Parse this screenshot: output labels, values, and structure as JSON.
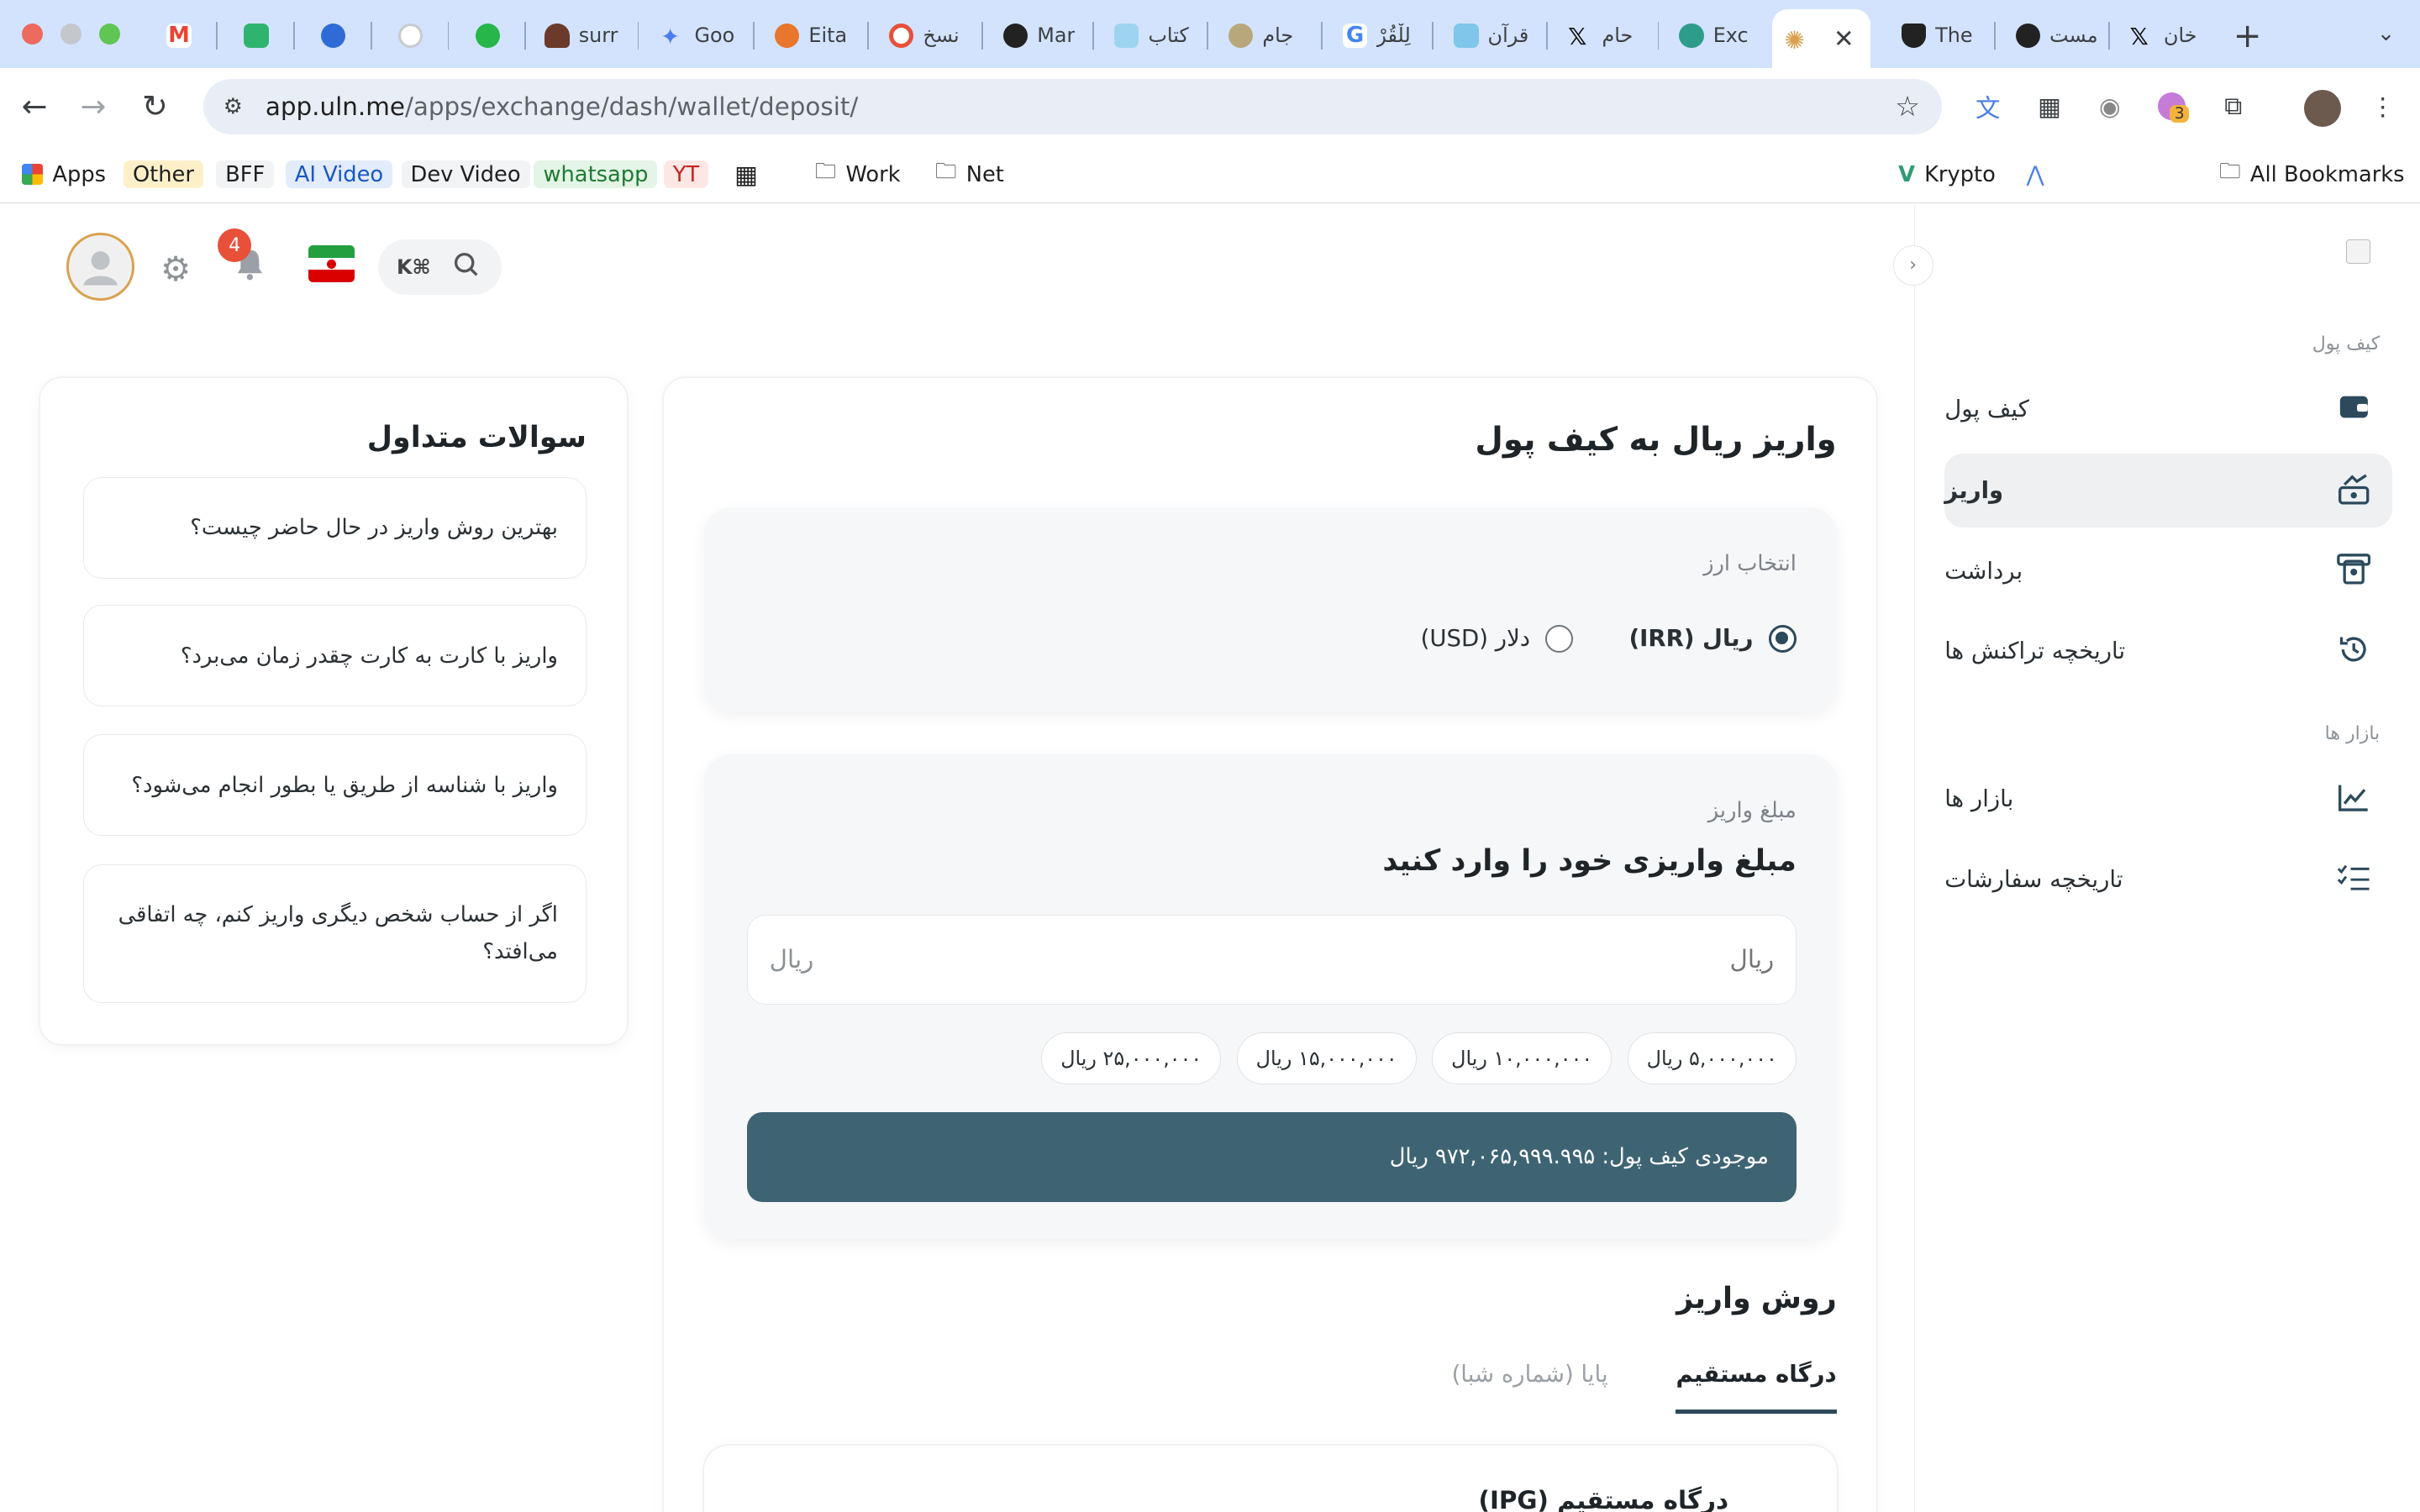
{
  "browser": {
    "tabs": [
      {
        "title": "",
        "color": "#ffffff"
      },
      {
        "title": "",
        "color": "#2fb46f"
      },
      {
        "title": "",
        "color": "#2f6bd6"
      },
      {
        "title": "",
        "color": "#c7cbd0"
      },
      {
        "title": "",
        "color": "#26b64a"
      },
      {
        "title": "surr",
        "color": "#6b3a2a"
      },
      {
        "title": "Goo",
        "color": "#4b7bf0"
      },
      {
        "title": "Eita",
        "color": "#e8762c"
      },
      {
        "title": "نسخ",
        "color": "#e8503a"
      },
      {
        "title": "Mar",
        "color": "#222222"
      },
      {
        "title": "کتاب",
        "color": "#9fd4f0"
      },
      {
        "title": "جام",
        "color": "#b8a77a"
      },
      {
        "title": "لِلْقُرْ",
        "color": "#4285f4"
      },
      {
        "title": "قرآن",
        "color": "#7fc6ea"
      },
      {
        "title": "حام",
        "color": "#111111"
      },
      {
        "title": "Exc",
        "color": "#2e9c8a"
      },
      {
        "title": "",
        "color": "#d9a14e"
      },
      {
        "title": "The",
        "color": "#222222"
      },
      {
        "title": "مست",
        "color": "#222222"
      },
      {
        "title": "خان",
        "color": "#111111"
      }
    ],
    "url_host": "app.uln.me",
    "url_path": "/apps/exchange/dash/wallet/deposit/",
    "ext_badge": "3",
    "bookmarks": {
      "apps": "Apps",
      "other": "Other",
      "bff": "BFF",
      "ai_video": "AI Video",
      "dev_video": "Dev Video",
      "whatsapp": "whatsapp",
      "yt": "YT",
      "work": "Work",
      "net": "Net",
      "krypto": "Krypto",
      "all": "All Bookmarks"
    }
  },
  "header": {
    "notifications": "4",
    "search_shortcut": "K⌘"
  },
  "sidebar": {
    "section_wallet": "کیف پول",
    "section_markets": "بازار ها",
    "items": [
      {
        "label": "کیف پول",
        "icon": "wallet-icon"
      },
      {
        "label": "واریز",
        "icon": "deposit-icon"
      },
      {
        "label": "برداشت",
        "icon": "withdraw-icon"
      },
      {
        "label": "تاریخچه تراکنش ها",
        "icon": "history-icon"
      },
      {
        "label": "بازار ها",
        "icon": "chart-icon"
      },
      {
        "label": "تاریخچه سفارشات",
        "icon": "orders-icon"
      }
    ]
  },
  "deposit": {
    "title": "واریز ریال به کیف پول",
    "currency_label": "انتخاب ارز",
    "currencies": [
      {
        "label": "ریال (IRR)",
        "selected": true
      },
      {
        "label": "دلار (USD)",
        "selected": false
      }
    ],
    "amount_label": "مبلغ واریز",
    "amount_title": "مبلغ واریزی خود را وارد کنید",
    "amount_placeholder": "ریال",
    "amount_unit": "ریال",
    "presets": [
      "۵,۰۰۰,۰۰۰ ریال",
      "۱۰,۰۰۰,۰۰۰ ریال",
      "۱۵,۰۰۰,۰۰۰ ریال",
      "۲۵,۰۰۰,۰۰۰ ریال"
    ],
    "balance": "موجودی کیف پول: ۹۷۲,۰۶۵,۹۹۹.۹۹۵ ریال",
    "method_title": "روش واریز",
    "method_tabs": [
      {
        "label": "درگاه مستقیم",
        "active": true
      },
      {
        "label": "پایا (شماره شبا)",
        "active": false
      }
    ],
    "ipg_title": "درگاه مستقیم (IPG)"
  },
  "faq": {
    "title": "سوالات متداول",
    "items": [
      "بهترین روش واریز در حال حاضر چیست؟",
      "واریز با کارت به کارت چقدر زمان می‌برد؟",
      "واریز با شناسه از طریق یا بطور انجام می‌شود؟",
      "اگر از حساب شخص دیگری واریز کنم، چه اتفاقی می‌افتد؟"
    ]
  },
  "colors": {
    "accent": "#2c4a5c",
    "balance_bg": "#3e6474",
    "badge": "#e8503a",
    "tab_strip": "#d3e3fd"
  }
}
